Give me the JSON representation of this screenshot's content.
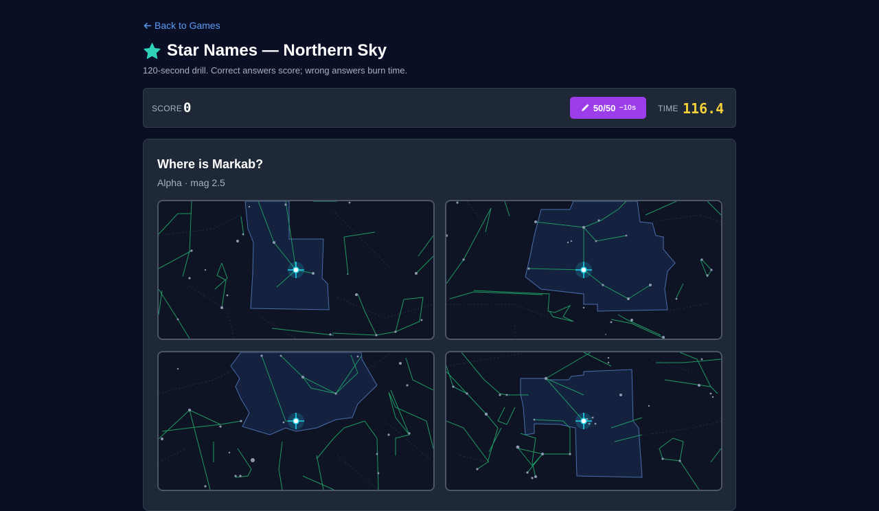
{
  "nav": {
    "back_label": "Back to Games"
  },
  "header": {
    "title": "Star Names — Northern Sky",
    "subtitle": "120-second drill. Correct answers score; wrong answers burn time.",
    "icon": "star-icon"
  },
  "hud": {
    "score_label": "SCORE",
    "score": "0",
    "hint_count": "50/50",
    "hint_cost": "−10s",
    "time_label": "TIME",
    "time": "116.4"
  },
  "question": {
    "prompt_prefix": "Where is ",
    "star_name": "Markab",
    "prompt_suffix": "?",
    "meta": "Alpha · mag 2.5"
  },
  "colors": {
    "accent_teal": "#2fd2b8",
    "link_blue": "#5b9cf5",
    "hint_purple": "#9b3de8",
    "time_yellow": "#f6d23a",
    "constellation_line": "#1f9a63",
    "boundary": "#4a6fae",
    "target_glow": "#22d3ee"
  },
  "options": [
    {
      "name": "option-a"
    },
    {
      "name": "option-b"
    },
    {
      "name": "option-c"
    },
    {
      "name": "option-d"
    }
  ]
}
